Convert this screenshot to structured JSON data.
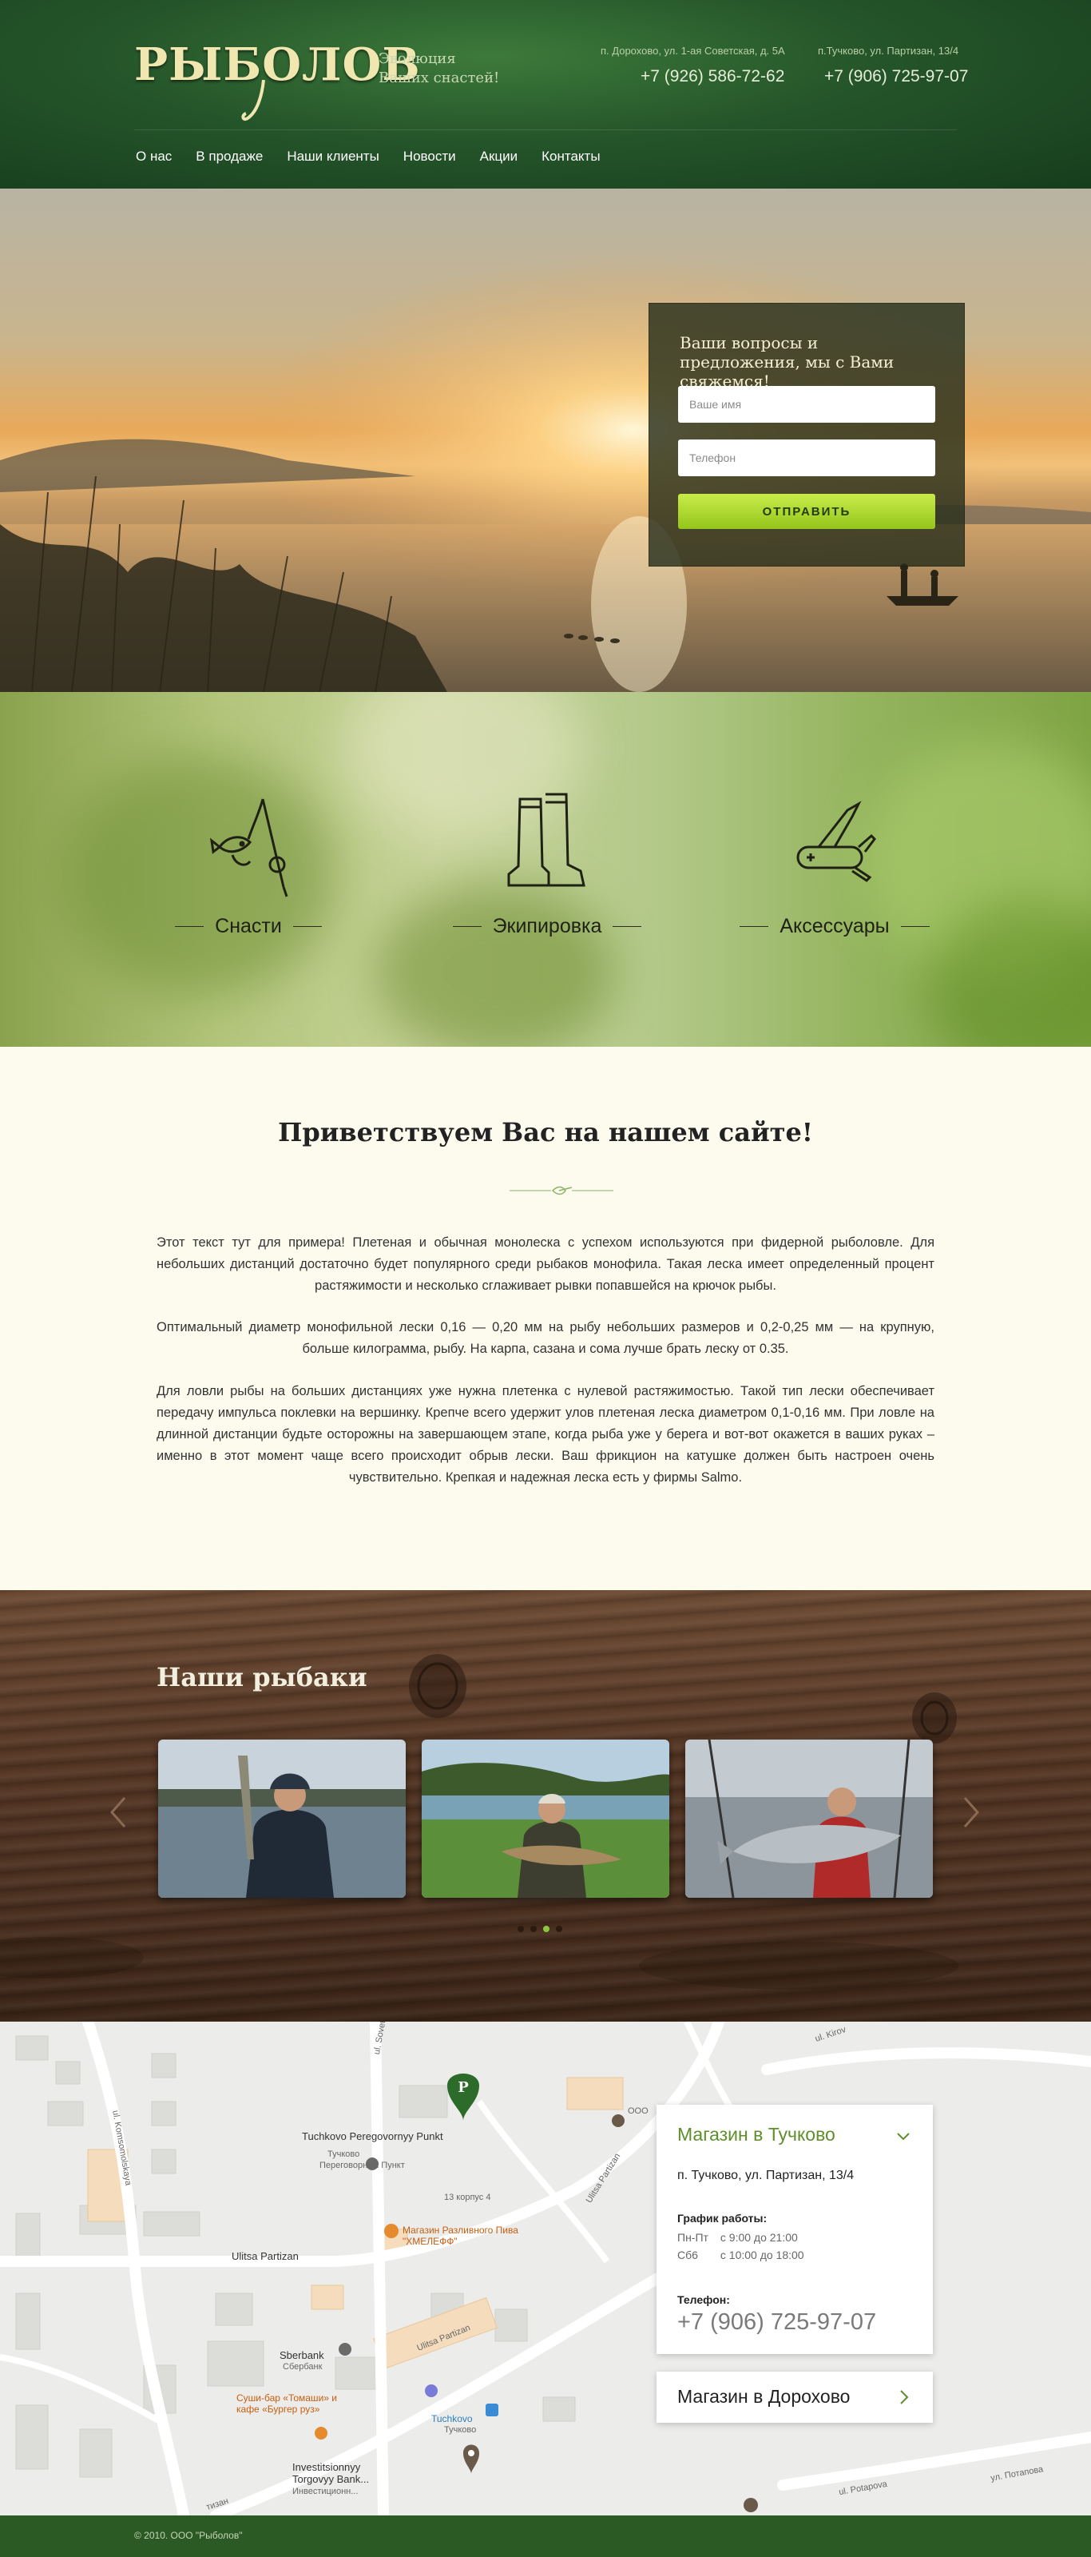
{
  "header": {
    "logo_text": "РЫБОЛОВ",
    "slogan_line1": "Эволюция",
    "slogan_line2": "Ваших снастей!",
    "store1_address": "п. Дорохово, ул. 1-ая Советская, д. 5А",
    "store1_phone": "+7 (926) 586-72-62",
    "store2_address": "п.Тучково, ул. Партизан, 13/4",
    "store2_phone": "+7 (906) 725-97-07"
  },
  "nav": {
    "items": [
      "О нас",
      "В продаже",
      "Наши клиенты",
      "Новости",
      "Акции",
      "Контакты"
    ]
  },
  "hero": {
    "form_title": "Ваши вопросы и предложения, мы с Вами свяжемся!",
    "name_placeholder": "Ваше имя",
    "phone_placeholder": "Телефон",
    "submit_label": "ОТПРАВИТЬ"
  },
  "categories": {
    "items": [
      {
        "label": "Снасти",
        "icon": "fishing-rod-icon"
      },
      {
        "label": "Экипировка",
        "icon": "boots-icon"
      },
      {
        "label": "Аксессуары",
        "icon": "multitool-knife-icon"
      }
    ]
  },
  "welcome": {
    "title": "Приветствуем Вас на нашем сайте!",
    "paragraphs": [
      "Этот текст тут для примера! Плетеная и обычная монолеска с успехом используются при фидерной рыболовле. Для небольших дистанций достаточно будет популярного среди рыбаков монофила. Такая леска имеет определенный процент растяжимости и несколько сглаживает рывки попавшейся на крючок рыбы.",
      "Оптимальный диаметр монофильной лески 0,16 — 0,20 мм на рыбу небольших размеров и 0,2-0,25 мм — на крупную, больше килограмма, рыбу. На карпа, сазана и сома лучше брать леску от 0.35.",
      "Для ловли рыбы на больших дистанциях уже нужна плетенка с нулевой растяжимостью. Такой тип лески обеспечивает передачу импульса поклевки на вершинку. Крепче всего удержит улов плетеная леска диаметром 0,1-0,16 мм. При ловле на длинной дистанции будьте осторожны на завершающем этапе, когда рыба уже у берега и вот-вот окажется в ваших руках – именно в этот момент чаще всего происходит обрыв лески. Ваш фрикцион на катушке должен быть настроен очень чувствительно. Крепкая и надежная леска есть у фирмы Salmo."
    ]
  },
  "fishermen": {
    "title": "Наши рыбаки",
    "active_slide": 3,
    "slide_count": 4
  },
  "map": {
    "labels": {
      "tuchkovo_post": "Tuchkovo Peregovornyy Punkt",
      "tuchkovo_post_ru": "Переговорный Пункт",
      "tuchkovo_small": "Тучково",
      "beer_shop": "Магазин Разливного Пива \"ХМЕЛЕФФ\"",
      "ulitsa_partizan": "Ulitsa Partizan",
      "ulitsa_partizan2": "Ulitsa Partizan",
      "sberbank": "Sberbank",
      "sberbank_ru": "Сбербанк",
      "sushi": "Суши-бар «Томаши» и кафе «Бургер руз»",
      "tuchkovo_station": "Tuchkovo",
      "tuchkovo_station_ru": "Тучково",
      "investitsionnyy": "Investitsionnyy Torgovyy Bank...",
      "investitsionnyy_ru": "Инвестиционн...",
      "sovetskaya": "ul. Sovetskaya",
      "komsomolskaya": "ul. Komsomolskaya",
      "korpus": "13 корпус 4",
      "ooo": "ООО",
      "potapova": "ul. Potapova",
      "potapova_ru": "ул. Потапова",
      "ulitsa_partizan3": "Ulitsa Partizan",
      "partizan_sm": "тизан",
      "kirov": "ul. Kirov"
    },
    "shop1": {
      "title": "Магазин в Тучково",
      "address": "п. Тучково, ул. Партизан, 13/4",
      "schedule_label": "График работы:",
      "weekdays_label": "Пн-Пт",
      "weekdays_hours": "с 9:00 до 21:00",
      "saturday_label": "Сб6",
      "saturday_hours": "с 10:00 до 18:00",
      "phone_label": "Телефон:",
      "phone": "+7 (906) 725-97-07"
    },
    "shop2": {
      "title": "Магазин в Дорохово"
    }
  },
  "footer": {
    "copyright": "© 2010. ООО \"Рыболов\""
  }
}
